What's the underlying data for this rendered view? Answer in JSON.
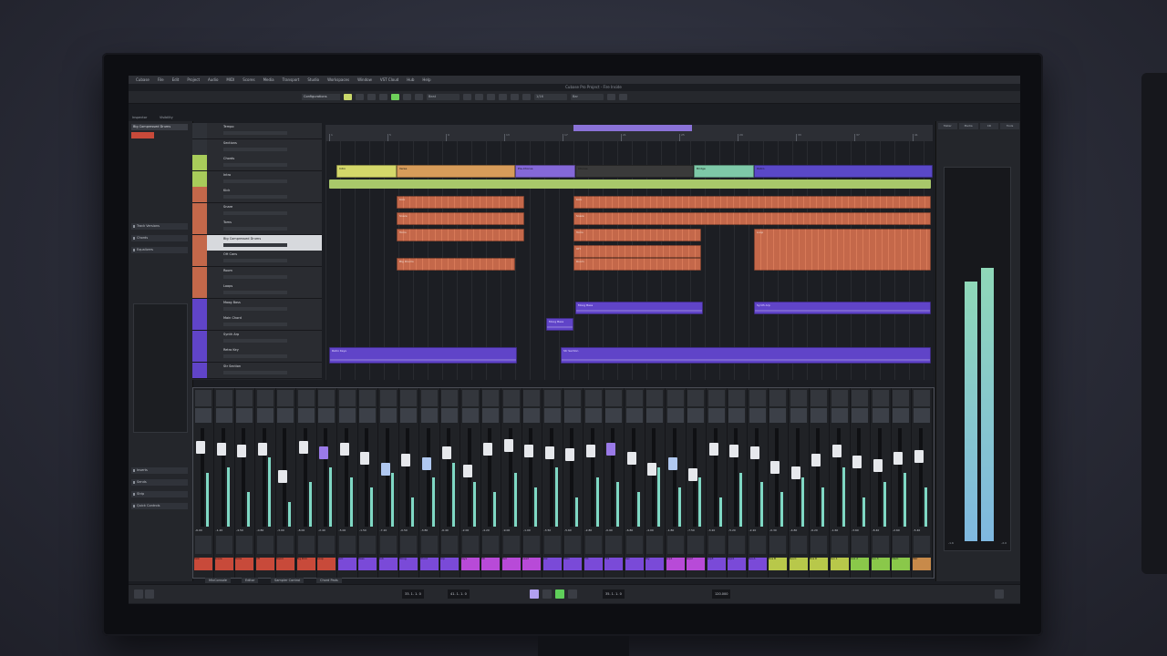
{
  "menu": [
    "Cubase",
    "File",
    "Edit",
    "Project",
    "Audio",
    "MIDI",
    "Scores",
    "Media",
    "Transport",
    "Studio",
    "Workspaces",
    "Window",
    "VST Cloud",
    "Hub",
    "Help"
  ],
  "window_title": "Cubase Pro Project - Fire Inside",
  "toolbar": {
    "configurations": "Configurations",
    "snap": "Beat",
    "quantize": "1/16",
    "grid": "Bar"
  },
  "left_zone": {
    "tabs": [
      "Inspector",
      "Visibility"
    ],
    "track_name": "Big Compressed Drums",
    "sections": [
      "Track Versions",
      "Chords",
      "Equalizers",
      "Inserts",
      "Sends",
      "Strip",
      "Quick Controls"
    ]
  },
  "tracks": [
    {
      "name": "Tempo",
      "color": "#2f3238"
    },
    {
      "name": "Sections",
      "color": "#2f3238"
    },
    {
      "name": "Chords",
      "color": "#a8cc5a"
    },
    {
      "name": "Intro",
      "color": "#a8cc5a"
    },
    {
      "name": "Kick",
      "color": "#c4684a"
    },
    {
      "name": "Snare",
      "color": "#c4684a"
    },
    {
      "name": "Toms",
      "color": "#c4684a"
    },
    {
      "name": "Big Compressed Drums",
      "color": "#c4684a"
    },
    {
      "name": "OH Cans",
      "color": "#c4684a"
    },
    {
      "name": "Room",
      "color": "#c4684a"
    },
    {
      "name": "Loops",
      "color": "#c4684a"
    },
    {
      "name": "Moog Bass",
      "color": "#6044c8"
    },
    {
      "name": "Main Chord",
      "color": "#6044c8"
    },
    {
      "name": "Synth Arp",
      "color": "#6044c8"
    },
    {
      "name": "Retro Key",
      "color": "#6044c8"
    },
    {
      "name": "Str Section",
      "color": "#6044c8"
    }
  ],
  "ruler_labels": [
    "1",
    "5",
    "9",
    "13",
    "17",
    "21",
    "25",
    "29",
    "33",
    "37",
    "41"
  ],
  "parts": {
    "section_row": [
      {
        "label": "Intro",
        "color": "#d4d86a"
      },
      {
        "label": "Verse",
        "color": "#d79c5a"
      },
      {
        "label": "Pre-Chorus",
        "color": "#8468d8"
      },
      {
        "label": "Chorus",
        "color": "#3a3a3a"
      },
      {
        "label": "Bridge",
        "color": "#7ec9a8"
      },
      {
        "label": "Outro",
        "color": "#5a48c8"
      }
    ],
    "audio": [
      "Kick",
      "Snare",
      "Toms",
      "Big Drums",
      "Kick",
      "Snare",
      "Toms",
      "OH",
      "Room",
      "Loop"
    ],
    "midi": [
      "Moog Bass",
      "Moog Bass",
      "Synth Arp",
      "Retro Keys",
      "Str Section"
    ]
  },
  "mixer": {
    "values": [
      "-6.00",
      "-1.20",
      "-4.50",
      "-0.80",
      "-3.00",
      "-8.00",
      "-2.40",
      "-5.00",
      "-1.50",
      "-7.20",
      "-0.50",
      "-3.80",
      "-6.40",
      "-2.00",
      "-4.20",
      "-9.00",
      "-1.00",
      "-3.50",
      "-5.60",
      "-2.80",
      "-0.90",
      "-6.80",
      "-4.00",
      "-1.80",
      "-7.50",
      "-3.20",
      "-5.20",
      "-2.20",
      "-0.30",
      "-4.80",
      "-6.20",
      "-1.60",
      "-3.60",
      "-8.40",
      "-2.60",
      "-5.40"
    ],
    "labels": [
      "Kick",
      "Snare",
      "Toms",
      "OH",
      "Room",
      "Big Drm",
      "Loop",
      "Perc",
      "Bass",
      "Sub",
      "Moog",
      "Chord",
      "Arp",
      "Keys",
      "Str",
      "Pad",
      "Lead",
      "Vox",
      "BVox",
      "FX1",
      "FX2",
      "Rev",
      "Dly",
      "Grp1",
      "Grp2",
      "Grp3",
      "Grp4",
      "Bus A",
      "Bus B",
      "Bus C",
      "Bus D",
      "Aux 1",
      "Aux 2",
      "Aux 3",
      "Stem",
      "Mstr"
    ],
    "label_colors": [
      "#c84a3a",
      "#c84a3a",
      "#c84a3a",
      "#c84a3a",
      "#c84a3a",
      "#c84a3a",
      "#c84a3a",
      "#7a4ad8",
      "#7a4ad8",
      "#7a4ad8",
      "#7a4ad8",
      "#7a4ad8",
      "#7a4ad8",
      "#b84ad8",
      "#b84ad8",
      "#b84ad8",
      "#b84ad8",
      "#7a4ad8",
      "#7a4ad8",
      "#7a4ad8",
      "#7a4ad8",
      "#7a4ad8",
      "#7a4ad8",
      "#b84ad8",
      "#b84ad8",
      "#7a4ad8",
      "#7a4ad8",
      "#7a4ad8",
      "#b8c84a",
      "#b8c84a",
      "#b8c84a",
      "#b8c84a",
      "#8ac84a",
      "#8ac84a",
      "#8ac84a",
      "#c88a4a"
    ]
  },
  "right_zone": {
    "tabs": [
      "Meter",
      "Media",
      "CR",
      "Tools"
    ],
    "peak_left": "-1.6",
    "peak_right": "-2.0"
  },
  "lower_tabs": [
    "MixConsole",
    "Editor",
    "Sampler Control",
    "Chord Pads"
  ],
  "transport": {
    "left_locator": "33. 1. 1. 0",
    "right_locator": "41. 1. 1. 0",
    "position": "35. 1. 1. 0",
    "tempo": "120.000"
  }
}
